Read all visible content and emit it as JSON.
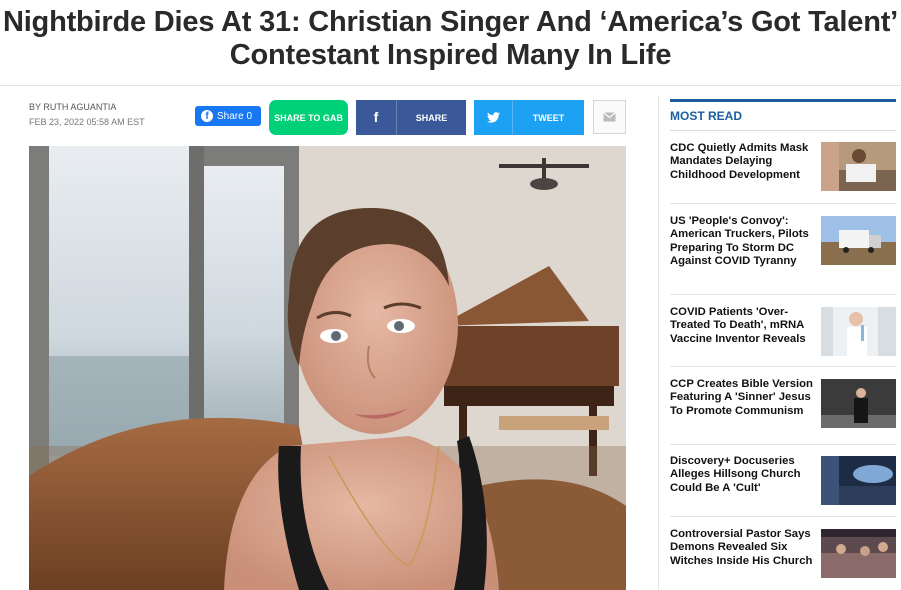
{
  "article": {
    "headline_line1": "Nightbirde Dies At 31: Christian Singer And ‘America’s Got Talent’",
    "headline_line2": "Contestant Inspired Many In Life",
    "byline": "BY RUTH AGUANTIA",
    "date": "FEB 23, 2022 05:58 AM EST"
  },
  "share": {
    "facebook_label": "Share 0",
    "gab_label": "SHARE TO GAB",
    "share_label": "SHARE",
    "tweet_label": "TWEET"
  },
  "most_read": {
    "title": "MOST READ",
    "items": [
      {
        "text": "CDC Quietly Admits Mask Mandates Delaying Childhood Development"
      },
      {
        "text": "US 'People's Convoy': American Truckers, Pilots Preparing To Storm DC Against COVID Tyranny"
      },
      {
        "text": "COVID Patients 'Over-Treated To Death', mRNA Vaccine Inventor Reveals"
      },
      {
        "text": "CCP Creates Bible Version Featuring A 'Sinner' Jesus To Promote Communism"
      },
      {
        "text": "Discovery+ Docuseries Alleges Hillsong Church Could Be A 'Cult'"
      },
      {
        "text": "Controversial Pastor Says Demons Revealed Six Witches Inside His Church"
      }
    ]
  },
  "colors": {
    "facebook": "#1877f2",
    "gab": "#00d178",
    "share": "#3b5998",
    "twitter": "#1da1f2",
    "most_read_accent": "#1b5ea0"
  }
}
